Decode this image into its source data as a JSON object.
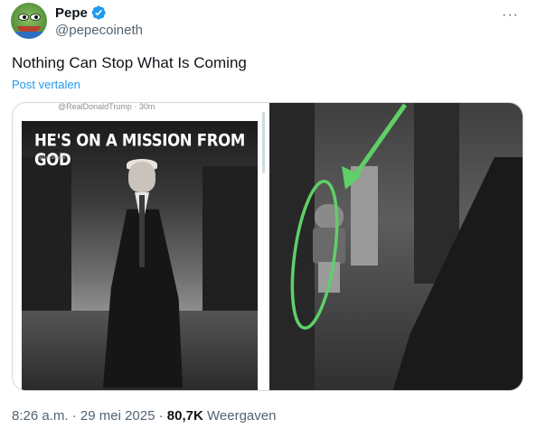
{
  "author": {
    "name": "Pepe",
    "handle": "@pepecoineth",
    "verified_color": "#1d9bf0"
  },
  "tweet": {
    "text": "Nothing Can Stop What Is Coming",
    "translate_label": "Post vertalen",
    "more_label": "···"
  },
  "media": {
    "left_poster_title": "HE'S ON A MISSION FROM GOD",
    "left_poster_credit": "@FruitSnacks",
    "left_top_caption": "@RealDonaldTrump · 30m"
  },
  "footer": {
    "time": "8:26 a.m.",
    "separator": " · ",
    "date": "29 mei 2025",
    "views_count": "80,7K",
    "views_label": "Weergaven"
  },
  "colors": {
    "accent": "#1d9bf0",
    "highlight": "#5fd068"
  }
}
